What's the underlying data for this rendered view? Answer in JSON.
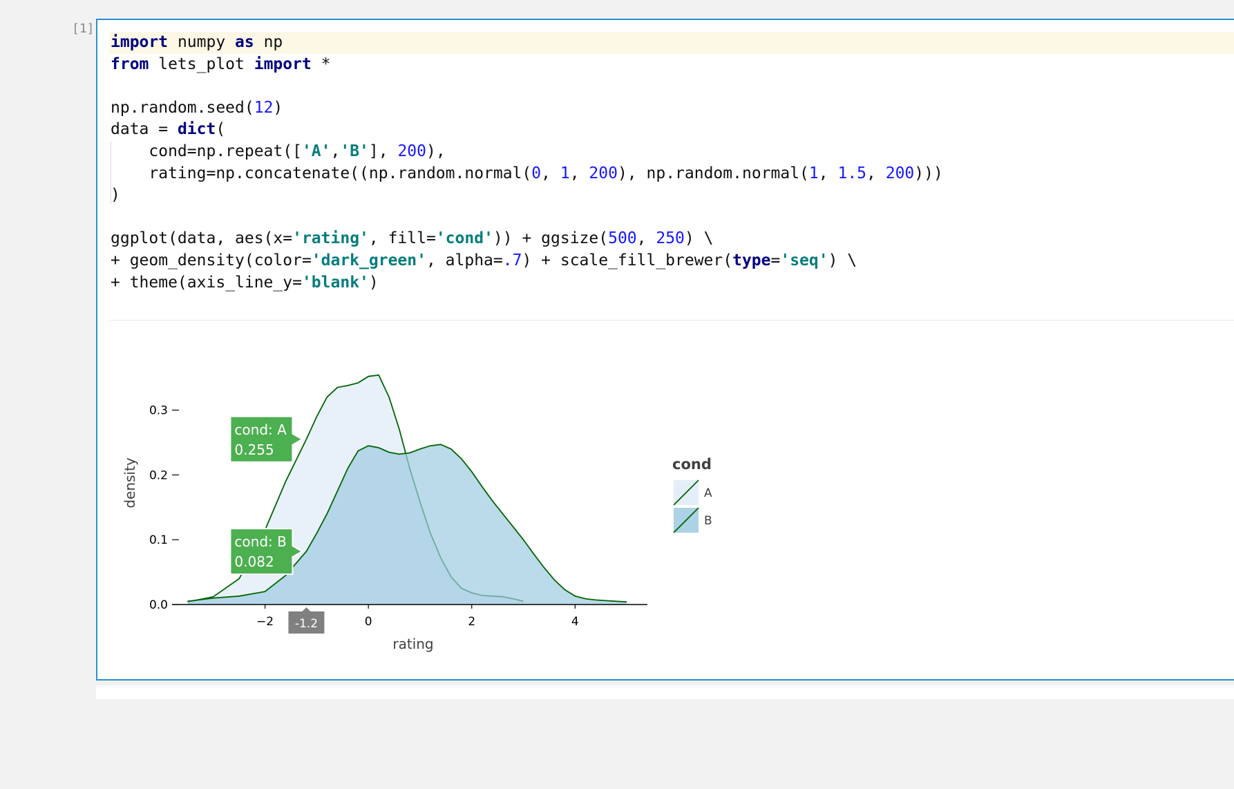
{
  "cell": {
    "prompt": "[1]",
    "code_lines": [
      [
        [
          "kw",
          "import"
        ],
        [
          "t",
          " numpy "
        ],
        [
          "kw",
          "as"
        ],
        [
          "t",
          " np"
        ]
      ],
      [
        [
          "kw",
          "from"
        ],
        [
          "t",
          " lets_plot "
        ],
        [
          "kw",
          "import"
        ],
        [
          "t",
          " *"
        ]
      ],
      [],
      [
        [
          "t",
          "np.random.seed("
        ],
        [
          "num",
          "12"
        ],
        [
          "t",
          ")"
        ]
      ],
      [
        [
          "t",
          "data = "
        ],
        [
          "kw",
          "dict"
        ],
        [
          "t",
          "("
        ]
      ],
      [
        [
          "t",
          "    cond=np.repeat(["
        ],
        [
          "str",
          "'A'"
        ],
        [
          "t",
          ","
        ],
        [
          "str",
          "'B'"
        ],
        [
          "t",
          "], "
        ],
        [
          "num",
          "200"
        ],
        [
          "t",
          "),"
        ]
      ],
      [
        [
          "t",
          "    rating=np.concatenate((np.random.normal("
        ],
        [
          "num",
          "0"
        ],
        [
          "t",
          ", "
        ],
        [
          "num",
          "1"
        ],
        [
          "t",
          ", "
        ],
        [
          "num",
          "200"
        ],
        [
          "t",
          "), np.random.normal("
        ],
        [
          "num",
          "1"
        ],
        [
          "t",
          ", "
        ],
        [
          "num",
          "1.5"
        ],
        [
          "t",
          ", "
        ],
        [
          "num",
          "200"
        ],
        [
          "t",
          ")))"
        ]
      ],
      [
        [
          "t",
          ")"
        ]
      ],
      [],
      [
        [
          "t",
          "ggplot(data, aes(x="
        ],
        [
          "str",
          "'rating'"
        ],
        [
          "t",
          ", fill="
        ],
        [
          "str",
          "'cond'"
        ],
        [
          "t",
          ")) + ggsize("
        ],
        [
          "num",
          "500"
        ],
        [
          "t",
          ", "
        ],
        [
          "num",
          "250"
        ],
        [
          "t",
          ") \\"
        ]
      ],
      [
        [
          "t",
          "+ geom_density(color="
        ],
        [
          "str",
          "'dark_green'"
        ],
        [
          "t",
          ", alpha="
        ],
        [
          "num",
          ".7"
        ],
        [
          "t",
          ") + scale_fill_brewer("
        ],
        [
          "kw",
          "type"
        ],
        [
          "t",
          "="
        ],
        [
          "str",
          "'seq'"
        ],
        [
          "t",
          ") \\"
        ]
      ],
      [
        [
          "t",
          "+ theme(axis_line_y="
        ],
        [
          "str",
          "'blank'"
        ],
        [
          "t",
          ")"
        ]
      ]
    ]
  },
  "chart_data": {
    "type": "area",
    "xlabel": "rating",
    "ylabel": "density",
    "xlim": [
      -3.8,
      5.4
    ],
    "ylim": [
      0,
      0.36
    ],
    "x_ticks": [
      -2,
      0,
      2,
      4
    ],
    "y_ticks": [
      0.0,
      0.1,
      0.2,
      0.3
    ],
    "y_tick_labels": [
      "0.0",
      "0.1",
      "0.2",
      "0.3"
    ],
    "line_color": "#006400",
    "legend": {
      "title": "cond",
      "position": "right"
    },
    "series": [
      {
        "name": "A",
        "fill": "#deebf7",
        "x": [
          -3.5,
          -3.0,
          -2.5,
          -2.0,
          -1.6,
          -1.2,
          -1.0,
          -0.8,
          -0.6,
          -0.4,
          -0.2,
          0.0,
          0.2,
          0.4,
          0.6,
          0.8,
          1.0,
          1.2,
          1.4,
          1.6,
          1.8,
          2.0,
          2.2,
          2.4,
          2.6,
          2.8,
          3.0
        ],
        "values": [
          0.004,
          0.012,
          0.04,
          0.115,
          0.19,
          0.255,
          0.29,
          0.32,
          0.335,
          0.338,
          0.342,
          0.352,
          0.354,
          0.32,
          0.27,
          0.21,
          0.158,
          0.11,
          0.072,
          0.043,
          0.025,
          0.018,
          0.014,
          0.013,
          0.012,
          0.009,
          0.005
        ]
      },
      {
        "name": "B",
        "fill": "#9ecae1",
        "x": [
          -3.5,
          -3.0,
          -2.5,
          -2.0,
          -1.6,
          -1.2,
          -1.0,
          -0.8,
          -0.6,
          -0.4,
          -0.2,
          0.0,
          0.2,
          0.4,
          0.6,
          0.8,
          1.0,
          1.2,
          1.4,
          1.6,
          1.8,
          2.0,
          2.2,
          2.4,
          2.6,
          2.8,
          3.0,
          3.2,
          3.4,
          3.6,
          3.8,
          4.0,
          4.2,
          4.4,
          4.6,
          5.0
        ],
        "values": [
          0.005,
          0.01,
          0.013,
          0.02,
          0.045,
          0.082,
          0.11,
          0.14,
          0.175,
          0.21,
          0.237,
          0.245,
          0.242,
          0.235,
          0.232,
          0.234,
          0.24,
          0.245,
          0.247,
          0.24,
          0.225,
          0.205,
          0.182,
          0.16,
          0.14,
          0.12,
          0.1,
          0.078,
          0.057,
          0.038,
          0.023,
          0.013,
          0.009,
          0.007,
          0.006,
          0.004
        ]
      }
    ],
    "tooltips": [
      {
        "label": "cond: A",
        "value": "0.255",
        "x": -1.2,
        "y": 0.255
      },
      {
        "label": "cond: B",
        "value": "0.082",
        "x": -1.2,
        "y": 0.082
      }
    ],
    "crosshair_label": "-1.2",
    "crosshair_x": -1.2
  }
}
